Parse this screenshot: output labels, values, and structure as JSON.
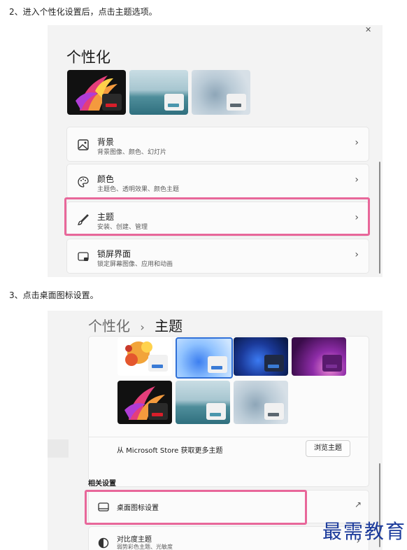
{
  "step2_caption": "2、进入个性化设置后，点击主题选项。",
  "step3_caption": "3、点击桌面图标设置。",
  "window1": {
    "close_glyph": "✕",
    "title": "个性化",
    "items": [
      {
        "label": "背景",
        "sub": "背景图像、颜色、幻灯片",
        "icon": "image-icon"
      },
      {
        "label": "颜色",
        "sub": "主题色、透明效果、颜色主题",
        "icon": "palette-icon"
      },
      {
        "label": "主题",
        "sub": "安装、创建、管理",
        "icon": "brush-icon"
      },
      {
        "label": "锁屏界面",
        "sub": "锁定屏幕图像、应用和动画",
        "icon": "lock-screen-icon"
      }
    ],
    "chevron": "›"
  },
  "window2": {
    "breadcrumb_parent": "个性化",
    "breadcrumb_sep": "›",
    "breadcrumb_current": "主题",
    "store_text": "从 Microsoft Store 获取更多主题",
    "browse_button": "浏览主题",
    "related_header": "相关设置",
    "desktop_icons_label": "桌面图标设置",
    "contrast_label": "对比度主题",
    "contrast_sub": "弱势彩色主题、光敏度",
    "external_glyph": "↗",
    "chevron": "›"
  },
  "watermark": "最需教育",
  "colors": {
    "highlight": "#e8679a",
    "watermark": "#1c3b9b"
  }
}
